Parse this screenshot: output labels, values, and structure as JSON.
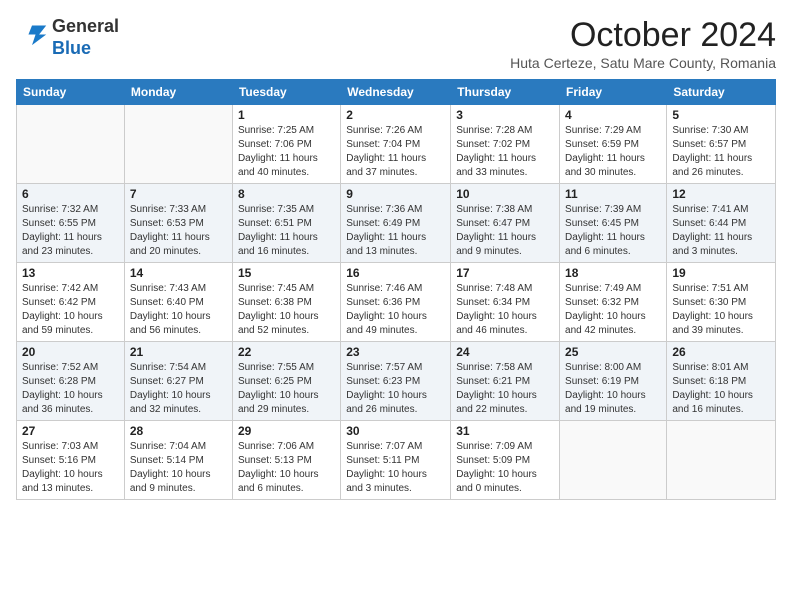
{
  "header": {
    "logo_line1": "General",
    "logo_line2": "Blue",
    "month": "October 2024",
    "location": "Huta Certeze, Satu Mare County, Romania"
  },
  "days_of_week": [
    "Sunday",
    "Monday",
    "Tuesday",
    "Wednesday",
    "Thursday",
    "Friday",
    "Saturday"
  ],
  "weeks": [
    [
      {
        "day": "",
        "info": ""
      },
      {
        "day": "",
        "info": ""
      },
      {
        "day": "1",
        "info": "Sunrise: 7:25 AM\nSunset: 7:06 PM\nDaylight: 11 hours and 40 minutes."
      },
      {
        "day": "2",
        "info": "Sunrise: 7:26 AM\nSunset: 7:04 PM\nDaylight: 11 hours and 37 minutes."
      },
      {
        "day": "3",
        "info": "Sunrise: 7:28 AM\nSunset: 7:02 PM\nDaylight: 11 hours and 33 minutes."
      },
      {
        "day": "4",
        "info": "Sunrise: 7:29 AM\nSunset: 6:59 PM\nDaylight: 11 hours and 30 minutes."
      },
      {
        "day": "5",
        "info": "Sunrise: 7:30 AM\nSunset: 6:57 PM\nDaylight: 11 hours and 26 minutes."
      }
    ],
    [
      {
        "day": "6",
        "info": "Sunrise: 7:32 AM\nSunset: 6:55 PM\nDaylight: 11 hours and 23 minutes."
      },
      {
        "day": "7",
        "info": "Sunrise: 7:33 AM\nSunset: 6:53 PM\nDaylight: 11 hours and 20 minutes."
      },
      {
        "day": "8",
        "info": "Sunrise: 7:35 AM\nSunset: 6:51 PM\nDaylight: 11 hours and 16 minutes."
      },
      {
        "day": "9",
        "info": "Sunrise: 7:36 AM\nSunset: 6:49 PM\nDaylight: 11 hours and 13 minutes."
      },
      {
        "day": "10",
        "info": "Sunrise: 7:38 AM\nSunset: 6:47 PM\nDaylight: 11 hours and 9 minutes."
      },
      {
        "day": "11",
        "info": "Sunrise: 7:39 AM\nSunset: 6:45 PM\nDaylight: 11 hours and 6 minutes."
      },
      {
        "day": "12",
        "info": "Sunrise: 7:41 AM\nSunset: 6:44 PM\nDaylight: 11 hours and 3 minutes."
      }
    ],
    [
      {
        "day": "13",
        "info": "Sunrise: 7:42 AM\nSunset: 6:42 PM\nDaylight: 10 hours and 59 minutes."
      },
      {
        "day": "14",
        "info": "Sunrise: 7:43 AM\nSunset: 6:40 PM\nDaylight: 10 hours and 56 minutes."
      },
      {
        "day": "15",
        "info": "Sunrise: 7:45 AM\nSunset: 6:38 PM\nDaylight: 10 hours and 52 minutes."
      },
      {
        "day": "16",
        "info": "Sunrise: 7:46 AM\nSunset: 6:36 PM\nDaylight: 10 hours and 49 minutes."
      },
      {
        "day": "17",
        "info": "Sunrise: 7:48 AM\nSunset: 6:34 PM\nDaylight: 10 hours and 46 minutes."
      },
      {
        "day": "18",
        "info": "Sunrise: 7:49 AM\nSunset: 6:32 PM\nDaylight: 10 hours and 42 minutes."
      },
      {
        "day": "19",
        "info": "Sunrise: 7:51 AM\nSunset: 6:30 PM\nDaylight: 10 hours and 39 minutes."
      }
    ],
    [
      {
        "day": "20",
        "info": "Sunrise: 7:52 AM\nSunset: 6:28 PM\nDaylight: 10 hours and 36 minutes."
      },
      {
        "day": "21",
        "info": "Sunrise: 7:54 AM\nSunset: 6:27 PM\nDaylight: 10 hours and 32 minutes."
      },
      {
        "day": "22",
        "info": "Sunrise: 7:55 AM\nSunset: 6:25 PM\nDaylight: 10 hours and 29 minutes."
      },
      {
        "day": "23",
        "info": "Sunrise: 7:57 AM\nSunset: 6:23 PM\nDaylight: 10 hours and 26 minutes."
      },
      {
        "day": "24",
        "info": "Sunrise: 7:58 AM\nSunset: 6:21 PM\nDaylight: 10 hours and 22 minutes."
      },
      {
        "day": "25",
        "info": "Sunrise: 8:00 AM\nSunset: 6:19 PM\nDaylight: 10 hours and 19 minutes."
      },
      {
        "day": "26",
        "info": "Sunrise: 8:01 AM\nSunset: 6:18 PM\nDaylight: 10 hours and 16 minutes."
      }
    ],
    [
      {
        "day": "27",
        "info": "Sunrise: 7:03 AM\nSunset: 5:16 PM\nDaylight: 10 hours and 13 minutes."
      },
      {
        "day": "28",
        "info": "Sunrise: 7:04 AM\nSunset: 5:14 PM\nDaylight: 10 hours and 9 minutes."
      },
      {
        "day": "29",
        "info": "Sunrise: 7:06 AM\nSunset: 5:13 PM\nDaylight: 10 hours and 6 minutes."
      },
      {
        "day": "30",
        "info": "Sunrise: 7:07 AM\nSunset: 5:11 PM\nDaylight: 10 hours and 3 minutes."
      },
      {
        "day": "31",
        "info": "Sunrise: 7:09 AM\nSunset: 5:09 PM\nDaylight: 10 hours and 0 minutes."
      },
      {
        "day": "",
        "info": ""
      },
      {
        "day": "",
        "info": ""
      }
    ]
  ]
}
